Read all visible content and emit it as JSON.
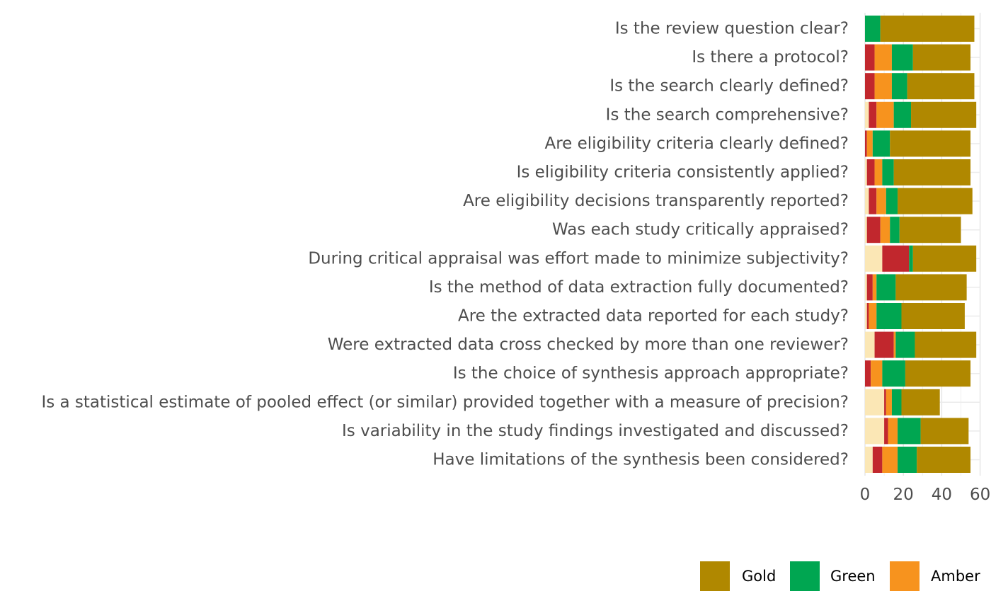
{
  "chart_data": {
    "type": "bar",
    "orientation": "horizontal",
    "stacked": true,
    "categories": [
      "Is the review question clear?",
      "Is there a protocol?",
      "Is the search clearly defined?",
      "Is the search comprehensive?",
      "Are eligibility criteria clearly defined?",
      "Is eligibility criteria consistently applied?",
      "Are eligibility decisions transparently reported?",
      "Was each study critically appraised?",
      "During critical appraisal was effort made to minimize subjectivity?",
      "Is the method of data extraction fully documented?",
      "Are the extracted data reported for each study?",
      "Were extracted data cross checked by more than one reviewer?",
      "Is the choice of synthesis approach appropriate?",
      "Is a statistical estimate of pooled effect (or similar) provided together with a measure of precision?",
      "Is variability in the study findings investigated and discussed?",
      "Have limitations of the synthesis been considered?"
    ],
    "series": [
      {
        "name": "",
        "color": "#fbe7b5",
        "values": [
          0,
          0,
          0,
          2,
          0,
          1,
          2,
          1,
          9,
          1,
          1,
          5,
          0,
          10,
          10,
          4
        ]
      },
      {
        "name": "",
        "color": "#c1272d",
        "values": [
          0,
          5,
          5,
          4,
          1,
          4,
          4,
          7,
          14,
          3,
          1,
          10,
          3,
          1,
          2,
          5
        ]
      },
      {
        "name": "Amber",
        "color": "#f7931e",
        "values": [
          0,
          9,
          9,
          9,
          3,
          4,
          5,
          5,
          0,
          2,
          4,
          1,
          6,
          3,
          5,
          8
        ]
      },
      {
        "name": "Green",
        "color": "#00a651",
        "values": [
          8,
          11,
          8,
          9,
          9,
          6,
          6,
          5,
          2,
          10,
          13,
          10,
          12,
          5,
          12,
          10
        ]
      },
      {
        "name": "Gold",
        "color": "#b08800",
        "values": [
          49,
          30,
          35,
          34,
          42,
          40,
          39,
          32,
          33,
          37,
          33,
          32,
          34,
          20,
          25,
          28
        ]
      }
    ],
    "xlim": [
      0,
      60
    ],
    "xticks": [
      "0",
      "20",
      "40",
      "60"
    ],
    "legend": {
      "position": "bottom-right",
      "entries": [
        {
          "label": "Gold",
          "color": "#b08800"
        },
        {
          "label": "Green",
          "color": "#00a651"
        },
        {
          "label": "Amber",
          "color": "#f7931e"
        }
      ]
    },
    "grid": true
  }
}
